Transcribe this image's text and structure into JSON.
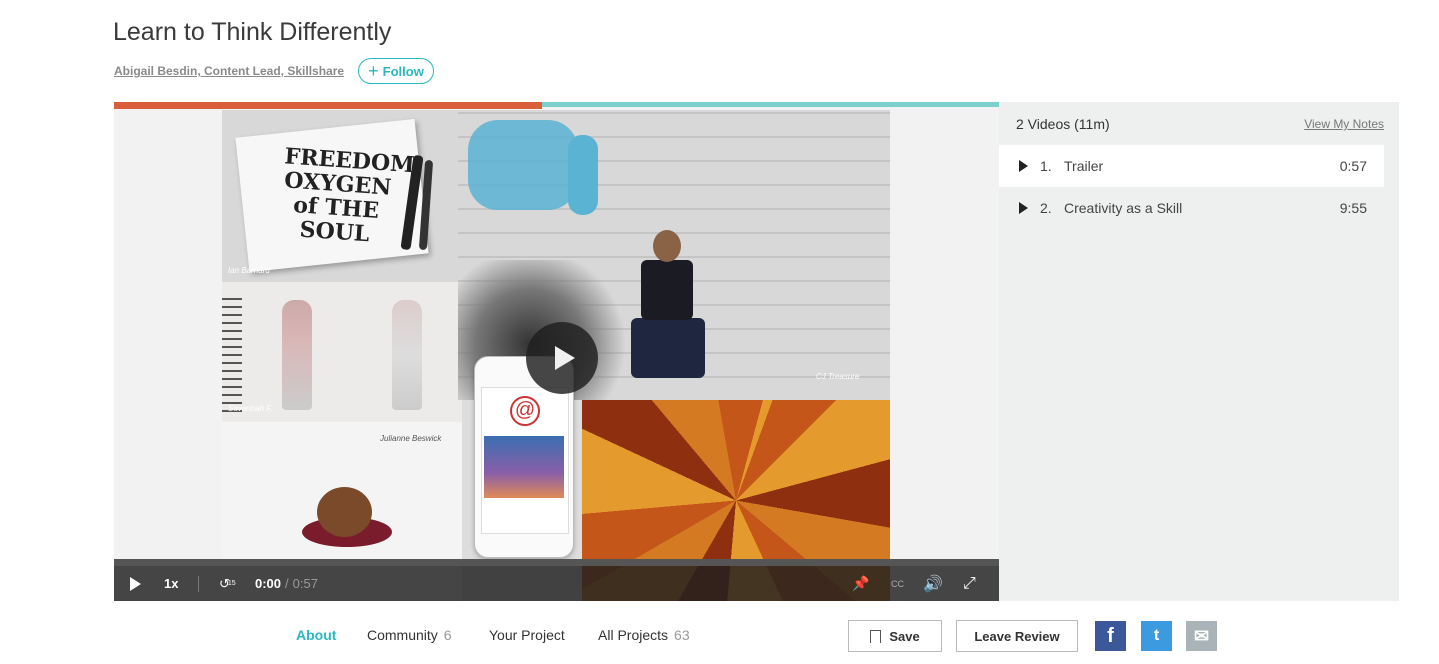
{
  "course": {
    "title": "Learn to Think Differently",
    "author": "Abigail Besdin, Content Lead, Skillshare",
    "follow_label": "Follow"
  },
  "player": {
    "speed": "1x",
    "rewind_label": "15",
    "current_time": "0:00",
    "duration": "0:57",
    "progress": 0.0,
    "cc_label": "CC",
    "collage_labels": {
      "freedom_art": "FREEDOM OXYGEN of THE SOUL",
      "credit_1": "Ian Barnard",
      "credit_2": "Savannah F.",
      "credit_3": "Julianne Beswick",
      "credit_4": "CJ Treasure"
    }
  },
  "sidebar": {
    "summary": "2 Videos (11m)",
    "notes_link": "View My Notes",
    "videos": [
      {
        "num": "1.",
        "title": "Trailer",
        "duration": "0:57"
      },
      {
        "num": "2.",
        "title": "Creativity as a Skill",
        "duration": "9:55"
      }
    ]
  },
  "tabs": [
    {
      "label": "About",
      "count": ""
    },
    {
      "label": "Community",
      "count": "6"
    },
    {
      "label": "Your Project",
      "count": ""
    },
    {
      "label": "All Projects",
      "count": "63"
    }
  ],
  "actions": {
    "save": "Save",
    "review": "Leave Review"
  },
  "share": {
    "facebook_icon": "f",
    "twitter_icon": "t",
    "mail_icon": "✉"
  },
  "colors": {
    "accent": "#28b8c0",
    "facebook": "#3b5998",
    "twitter": "#3b9ae0",
    "mail": "#aab3b8"
  }
}
